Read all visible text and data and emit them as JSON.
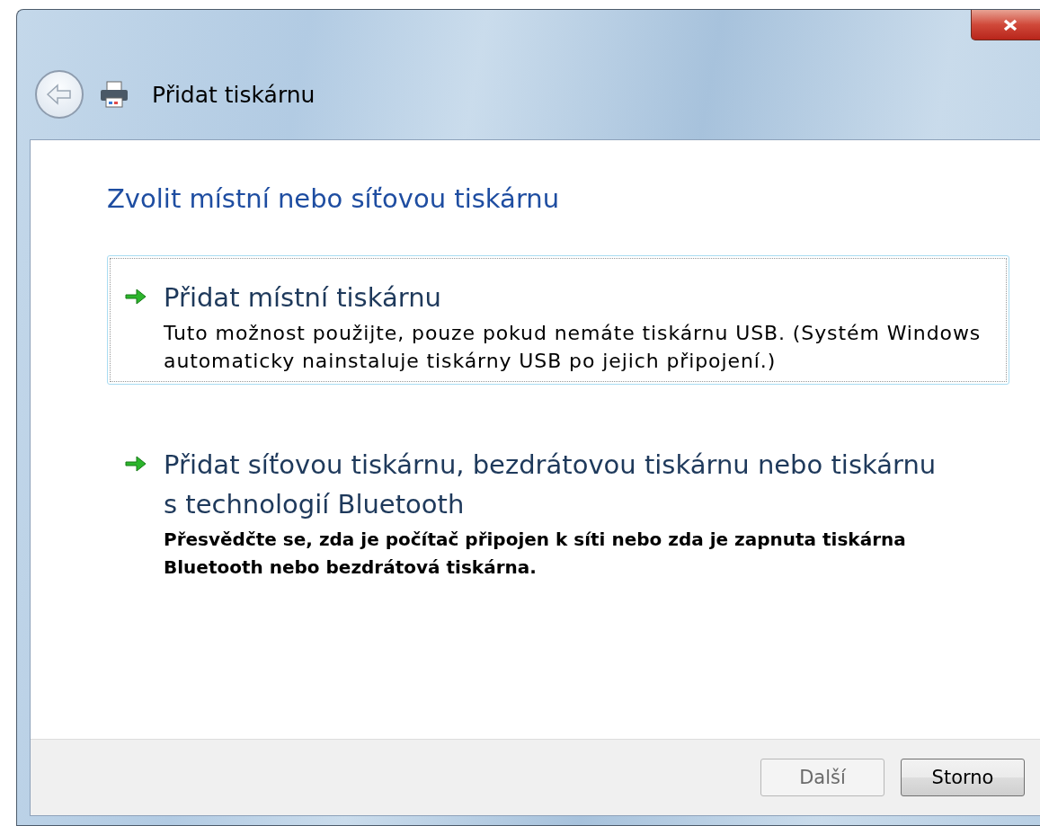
{
  "window": {
    "title": "Přidat tiskárnu"
  },
  "heading": "Zvolit místní nebo síťovou tiskárnu",
  "options": [
    {
      "title": "Přidat místní tiskárnu",
      "description": "Tuto možnost použijte, pouze pokud nemáte tiskárnu USB. (Systém Windows automaticky nainstaluje tiskárny USB po jejich připojení.)",
      "selected": true,
      "emphasized": false
    },
    {
      "title": "Přidat síťovou tiskárnu, bezdrátovou tiskárnu nebo tiskárnu s technologií Bluetooth",
      "description": "Přesvědčte se, zda je počítač připojen k síti nebo zda je zapnuta tiskárna Bluetooth nebo bezdrátová tiskárna.",
      "selected": false,
      "emphasized": true
    }
  ],
  "buttons": [
    {
      "label": "Další",
      "disabled": true
    },
    {
      "label": "Storno",
      "disabled": false
    }
  ]
}
